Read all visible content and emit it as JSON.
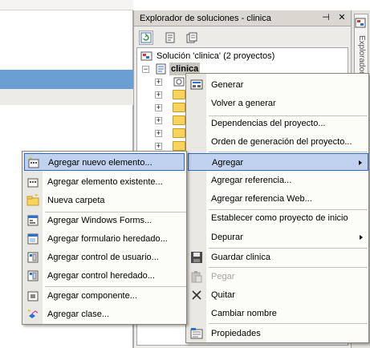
{
  "explorer": {
    "title": "Explorador de soluciones - clinica",
    "pin_glyph": "⊣",
    "close_glyph": "✕",
    "toolbar_icons": [
      "refresh-icon",
      "properties-icon",
      "show-all-files-icon"
    ],
    "tree": {
      "solution_label": "Solución 'clinica' (2 proyectos)",
      "project_label": "clinica"
    }
  },
  "side_tab": {
    "label": "Explorador"
  },
  "context_menu": {
    "items": [
      {
        "label": "Generar",
        "icon": "build-icon"
      },
      {
        "label": "Volver a generar",
        "icon": ""
      },
      {
        "label": "Dependencias del proyecto...",
        "icon": ""
      },
      {
        "label": "Orden de generación del proyecto...",
        "icon": ""
      },
      {
        "label": "Agregar",
        "icon": "",
        "highlighted": true,
        "submenu": true
      },
      {
        "label": "Agregar referencia...",
        "icon": ""
      },
      {
        "label": "Agregar referencia Web...",
        "icon": ""
      },
      {
        "label": "Establecer como proyecto de inicio",
        "icon": ""
      },
      {
        "label": "Depurar",
        "icon": "",
        "submenu": true
      },
      {
        "label": "Guardar clinica",
        "icon": "save-icon"
      },
      {
        "label": "Pegar",
        "icon": "paste-icon",
        "disabled": true
      },
      {
        "label": "Quitar",
        "icon": "delete-icon"
      },
      {
        "label": "Cambiar nombre",
        "icon": ""
      },
      {
        "label": "Propiedades",
        "icon": "properties-icon"
      }
    ]
  },
  "add_submenu": {
    "items": [
      {
        "label": "Agregar nuevo elemento...",
        "icon": "new-item-icon",
        "highlighted": true
      },
      {
        "label": "Agregar elemento existente...",
        "icon": "existing-item-icon"
      },
      {
        "label": "Nueva carpeta",
        "icon": "new-folder-icon"
      },
      {
        "label": "Agregar Windows Forms...",
        "icon": "windows-form-icon"
      },
      {
        "label": "Agregar formulario heredado...",
        "icon": "inherited-form-icon"
      },
      {
        "label": "Agregar control de usuario...",
        "icon": "user-control-icon"
      },
      {
        "label": "Agregar control heredado...",
        "icon": "inherited-control-icon"
      },
      {
        "label": "Agregar componente...",
        "icon": "component-icon"
      },
      {
        "label": "Agregar clase...",
        "icon": "class-icon"
      }
    ]
  },
  "colors": {
    "highlight_bg": "#c1d2ee",
    "highlight_border": "#316ac5",
    "selection_band": "#6b9ed3",
    "menu_gutter": "#e9e7e1"
  }
}
